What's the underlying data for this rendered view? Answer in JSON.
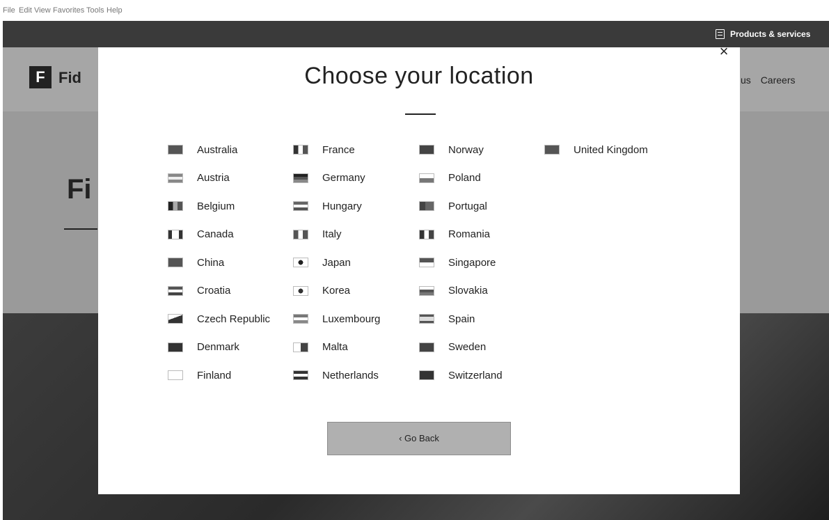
{
  "menu": [
    "File",
    "Edit",
    "View",
    "Favorites",
    "Tools",
    "Help"
  ],
  "header": {
    "products_label": "Products & services"
  },
  "site": {
    "logo_letter": "F",
    "logo_text": "Fid",
    "hero_text": "Fi",
    "nav_links": [
      "us",
      "Careers"
    ]
  },
  "modal": {
    "title": "Choose your location",
    "close_glyph": "×",
    "go_back_label": "‹ Go Back",
    "columns": [
      [
        {
          "label": "Australia",
          "flag": "australia-flag-icon"
        },
        {
          "label": "Austria",
          "flag": "austria-flag-icon"
        },
        {
          "label": "Belgium",
          "flag": "belgium-flag-icon"
        },
        {
          "label": "Canada",
          "flag": "canada-flag-icon"
        },
        {
          "label": "China",
          "flag": "china-flag-icon"
        },
        {
          "label": "Croatia",
          "flag": "croatia-flag-icon"
        },
        {
          "label": "Czech Republic",
          "flag": "czech-flag-icon"
        },
        {
          "label": "Denmark",
          "flag": "denmark-flag-icon"
        },
        {
          "label": "Finland",
          "flag": "finland-flag-icon"
        }
      ],
      [
        {
          "label": "France",
          "flag": "france-flag-icon"
        },
        {
          "label": "Germany",
          "flag": "germany-flag-icon"
        },
        {
          "label": "Hungary",
          "flag": "hungary-flag-icon"
        },
        {
          "label": "Italy",
          "flag": "italy-flag-icon"
        },
        {
          "label": "Japan",
          "flag": "japan-flag-icon"
        },
        {
          "label": "Korea",
          "flag": "korea-flag-icon"
        },
        {
          "label": "Luxembourg",
          "flag": "luxembourg-flag-icon"
        },
        {
          "label": "Malta",
          "flag": "malta-flag-icon"
        },
        {
          "label": "Netherlands",
          "flag": "netherlands-flag-icon"
        }
      ],
      [
        {
          "label": "Norway",
          "flag": "norway-flag-icon"
        },
        {
          "label": "Poland",
          "flag": "poland-flag-icon"
        },
        {
          "label": "Portugal",
          "flag": "portugal-flag-icon"
        },
        {
          "label": "Romania",
          "flag": "romania-flag-icon"
        },
        {
          "label": "Singapore",
          "flag": "singapore-flag-icon"
        },
        {
          "label": "Slovakia",
          "flag": "slovakia-flag-icon"
        },
        {
          "label": "Spain",
          "flag": "spain-flag-icon"
        },
        {
          "label": "Sweden",
          "flag": "sweden-flag-icon"
        },
        {
          "label": "Switzerland",
          "flag": "switzerland-flag-icon"
        }
      ],
      [
        {
          "label": "United Kingdom",
          "flag": "uk-flag-icon"
        }
      ]
    ]
  }
}
